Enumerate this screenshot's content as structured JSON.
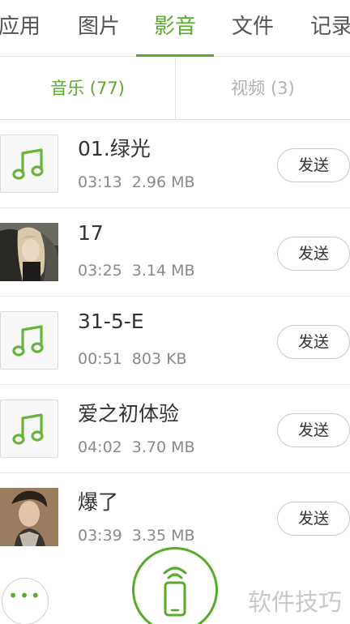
{
  "top_tabs": [
    {
      "label": "应用",
      "active": false
    },
    {
      "label": "图片",
      "active": false
    },
    {
      "label": "影音",
      "active": true
    },
    {
      "label": "文件",
      "active": false
    },
    {
      "label": "记录",
      "active": false
    }
  ],
  "sub_tabs": {
    "music": "音乐 (77)",
    "video": "视频 (3)"
  },
  "songs": [
    {
      "title": "01.绿光",
      "duration": "03:13",
      "size": "2.96 MB",
      "thumb": "music-note-icon",
      "send": "发送"
    },
    {
      "title": "17",
      "duration": "03:25",
      "size": "3.14 MB",
      "thumb": "album-art-photo",
      "send": "发送"
    },
    {
      "title": "31-5-E",
      "duration": "00:51",
      "size": "803 KB",
      "thumb": "music-note-icon",
      "send": "发送"
    },
    {
      "title": "爱之初体验",
      "duration": "04:02",
      "size": "3.70 MB",
      "thumb": "music-note-icon",
      "send": "发送"
    },
    {
      "title": "爆了",
      "duration": "03:39",
      "size": "3.35 MB",
      "thumb": "album-art-photo",
      "send": "发送"
    }
  ],
  "bottom": {
    "more_icon": "more-dots-icon",
    "more_glyph": "•••",
    "center_icon": "phone-signal-icon",
    "watermark": "软件技巧"
  },
  "colors": {
    "accent": "#5aaa2c",
    "text": "#333333",
    "muted": "#8a8a8a",
    "divider": "#e2e2e2"
  }
}
